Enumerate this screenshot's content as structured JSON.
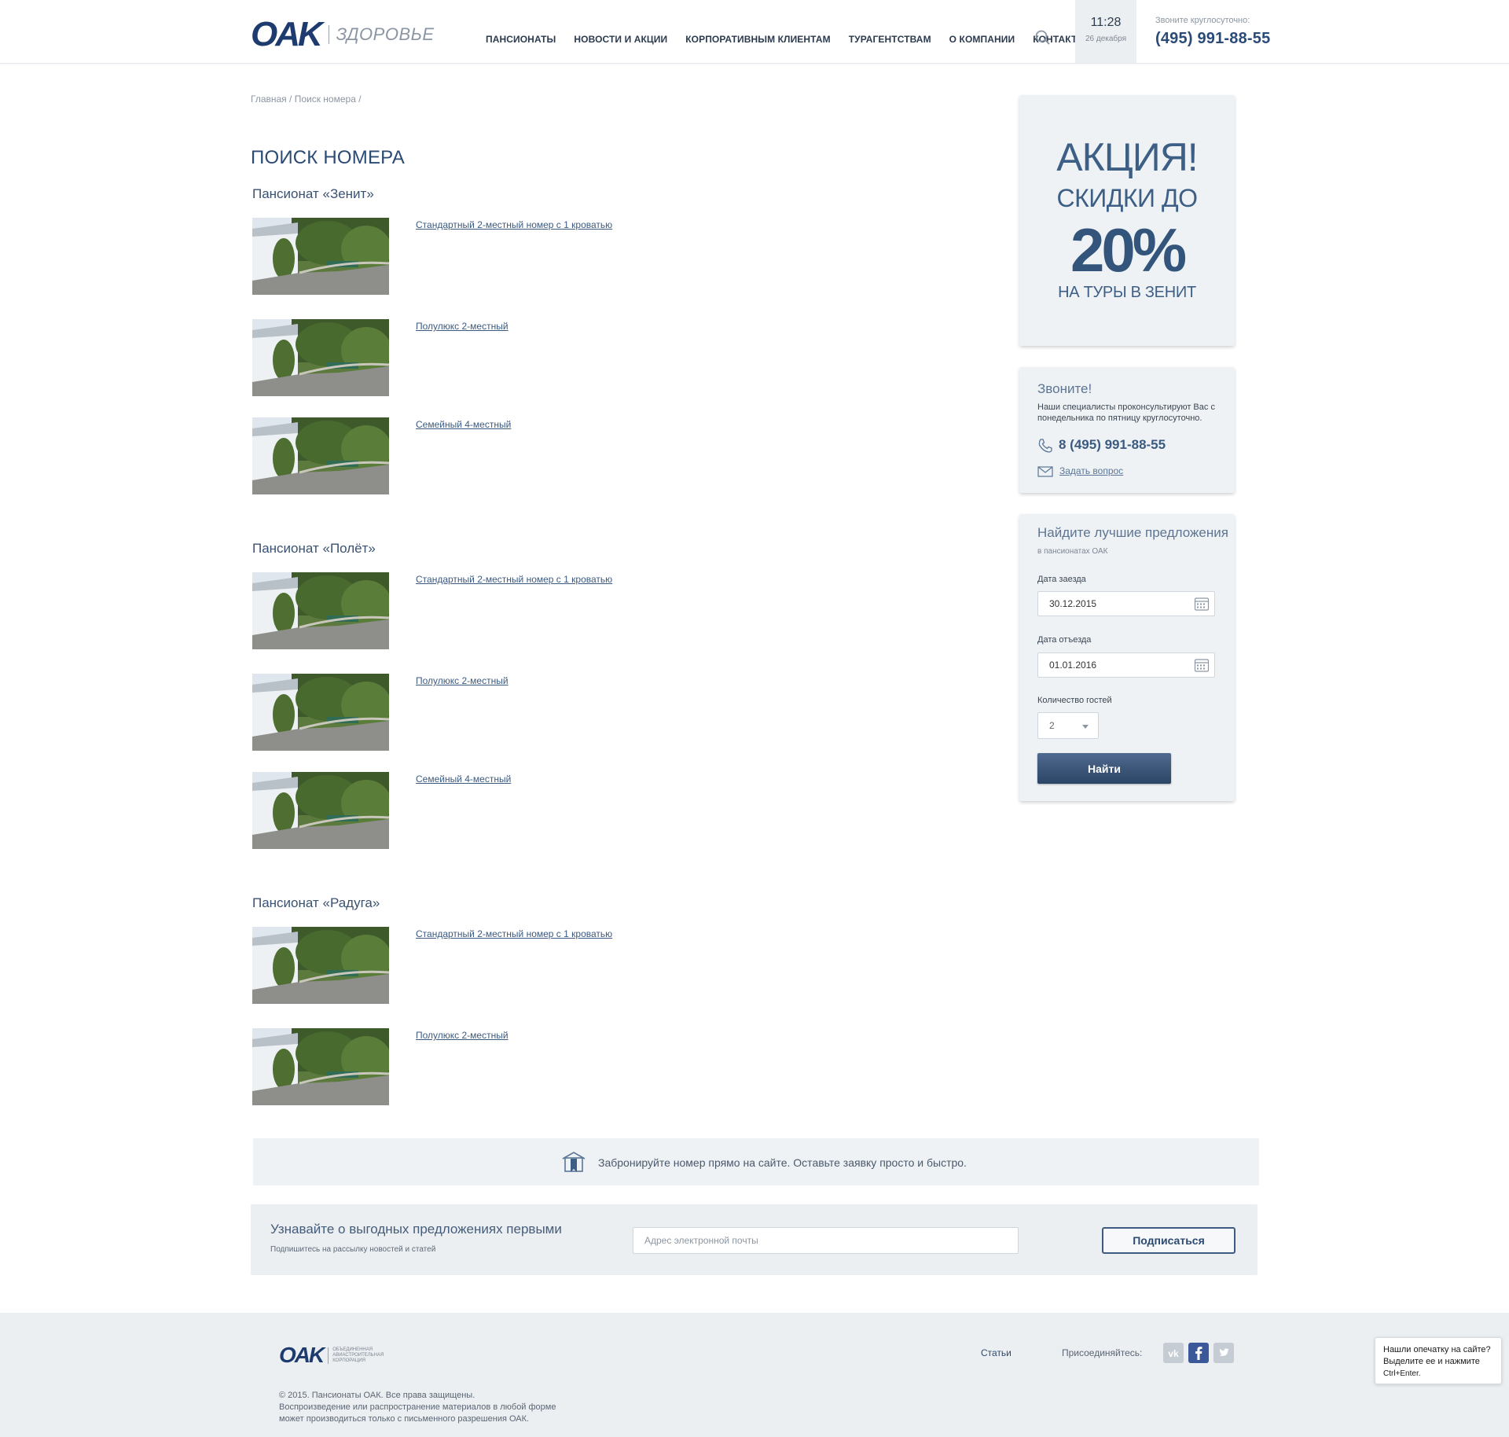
{
  "header": {
    "logo_text": "OAK",
    "logo_sub": "ЗДОРОВЬЕ",
    "nav": [
      "ПАНСИОНАТЫ",
      "НОВОСТИ И АКЦИИ",
      "КОРПОРАТИВНЫМ КЛИЕНТАМ",
      "ТУРАГЕНТСТВАМ",
      "О КОМПАНИИ",
      "КОНТАКТЫ"
    ],
    "time": "11:28",
    "date": "26 декабря",
    "call_label": "Звоните круглосуточно:",
    "phone": "(495) 991-88-55"
  },
  "breadcrumb": {
    "home": "Главная",
    "current": "Поиск номера"
  },
  "page_title": "ПОИСК НОМЕРА",
  "groups": [
    {
      "name": "Пансионат «Зенит»",
      "rooms": [
        "Стандартный 2-местный номер с 1 кроватью",
        "Полулюкс 2-местный",
        "Семейный 4-местный"
      ]
    },
    {
      "name": "Пансионат «Полёт»",
      "rooms": [
        "Стандартный 2-местный номер с 1 кроватью",
        "Полулюкс 2-местный",
        "Семейный 4-местный"
      ]
    },
    {
      "name": "Пансионат «Радуга»",
      "rooms": [
        "Стандартный 2-местный номер с 1 кроватью",
        "Полулюкс 2-местный"
      ]
    }
  ],
  "promo": {
    "line1": "АКЦИЯ!",
    "line2": "СКИДКИ ДО",
    "line3": "20%",
    "line4": "НА ТУРЫ В ЗЕНИТ"
  },
  "contact": {
    "title": "Звоните!",
    "text": "Наши специалисты проконсультируют Вас с понедельника по пятницу круглосуточно.",
    "phone": "8 (495) 991-88-55",
    "ask": "Задать вопрос"
  },
  "search": {
    "title": "Найдите лучшие предложения",
    "subtitle": "в пансионатах ОАК",
    "checkin_label": "Дата заезда",
    "checkin_value": "30.12.2015",
    "checkout_label": "Дата отъезда",
    "checkout_value": "01.01.2016",
    "guests_label": "Количество гостей",
    "guests_value": "2",
    "button": "Найти"
  },
  "booking_banner": "Забронируйте номер прямо на сайте. Оставьте заявку просто и быстро.",
  "newsletter": {
    "title": "Узнавайте о выгодных предложениях первыми",
    "subtitle": "Подпишитесь на рассылку новостей и статей",
    "placeholder": "Адрес электронной почты",
    "button": "Подписаться"
  },
  "footer": {
    "logo_text": "OAK",
    "logo_corp": "ОБЪЕДИНЕННАЯ АВИАСТРОИТЕЛЬНАЯ КОРПОРАЦИЯ",
    "copyright": "© 2015. Пансионаты ОАК. Все права защищены.",
    "notice1": "Воспроизведение или распространение материалов в любой форме",
    "notice2": "может производиться только с письменного разрешения ОАК.",
    "articles": "Статьи",
    "join": "Присоединяйтесь:"
  },
  "typo_notice": {
    "line1": "Нашли опечатку на сайте?",
    "line2": "Выделите ее и нажмите",
    "line3": "Ctrl+Enter."
  },
  "colors": {
    "brand": "#1d3b6f",
    "accent": "#3d5f86",
    "panel": "#eff2f5"
  }
}
